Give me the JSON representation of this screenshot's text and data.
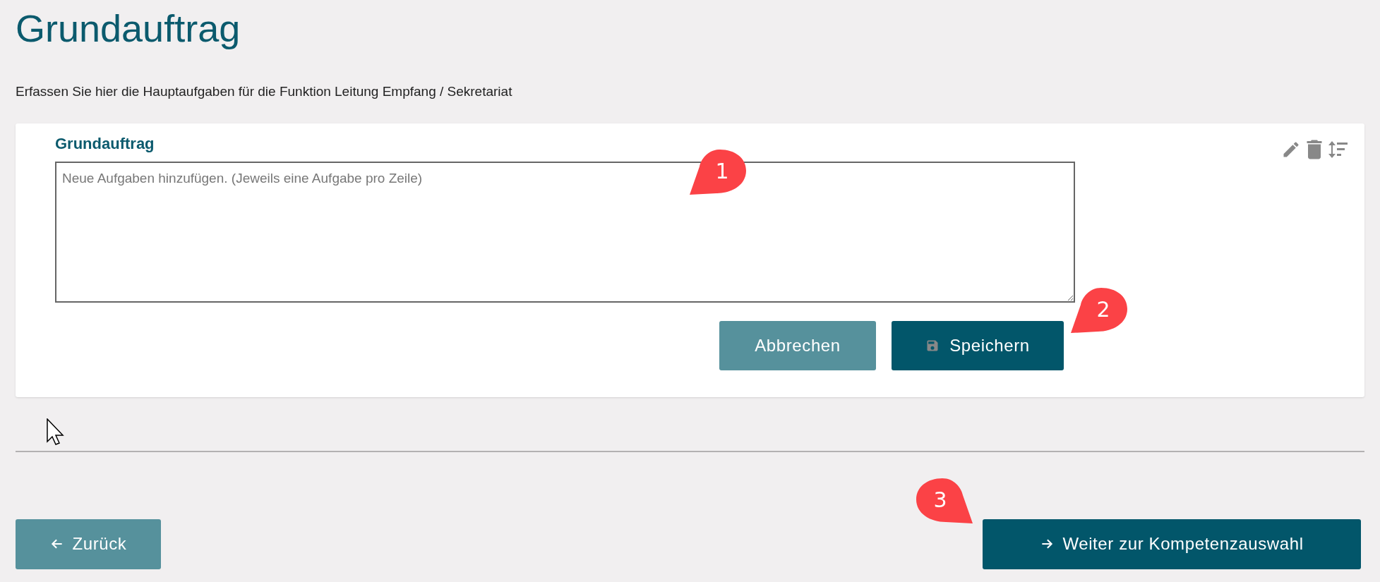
{
  "page": {
    "title": "Grundauftrag",
    "description": "Erfassen Sie hier die Hauptaufgaben für die Funktion Leitung Empfang / Sekretariat"
  },
  "card": {
    "label": "Grundauftrag",
    "textarea": {
      "placeholder": "Neue Aufgaben hinzufügen. (Jeweils eine Aufgabe pro Zeile)"
    },
    "buttons": [
      {
        "label": "Abbrechen",
        "kind": "secondary"
      },
      {
        "label": "Speichern",
        "kind": "primary"
      }
    ]
  },
  "footer": {
    "back": {
      "label": "Zurück"
    },
    "next": {
      "label": "Weiter zur Kompetenzauswahl"
    }
  },
  "annotations": [
    {
      "number": "1",
      "kind": "tail-left"
    },
    {
      "number": "2",
      "kind": "tail-left"
    },
    {
      "number": "3",
      "kind": "tail-right"
    }
  ]
}
